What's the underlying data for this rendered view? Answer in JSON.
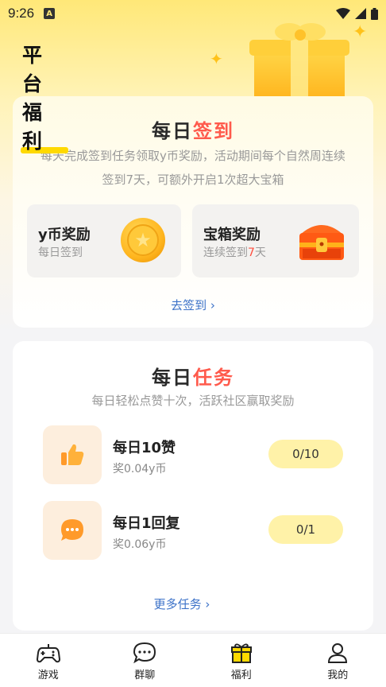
{
  "status_bar": {
    "time": "9:26",
    "a_badge": "A"
  },
  "header": {
    "title": "平台福利"
  },
  "checkin": {
    "title_a": "每日",
    "title_b": "签到",
    "description_line1": "每天完成签到任务领取y币奖励，活动期间每个自然周连续",
    "description_line2": "签到7天，可额外开启1次超大宝箱",
    "coin_reward": {
      "title": "y币奖励",
      "subtitle": "每日签到"
    },
    "chest_reward": {
      "title": "宝箱奖励",
      "subtitle_a": "连续签到",
      "subtitle_days": "7",
      "subtitle_b": "天"
    },
    "action_link": "去签到"
  },
  "tasks": {
    "title_a": "每日",
    "title_b": "任务",
    "description": "每日轻松点赞十次，活跃社区赢取奖励",
    "items": [
      {
        "title": "每日10赞",
        "reward": "奖0.04y币",
        "progress": "0/10",
        "icon": "thumbs-up-icon"
      },
      {
        "title": "每日1回复",
        "reward": "奖0.06y币",
        "progress": "0/1",
        "icon": "chat-bubble-icon"
      }
    ],
    "more_link": "更多任务"
  },
  "tabbar": {
    "items": [
      {
        "label": "游戏",
        "icon": "gamepad-icon"
      },
      {
        "label": "群聊",
        "icon": "chat-icon"
      },
      {
        "label": "福利",
        "icon": "gift-icon"
      },
      {
        "label": "我的",
        "icon": "user-icon"
      }
    ]
  },
  "colors": {
    "accent_yellow": "#ffd900",
    "accent_red": "#ff5a4c",
    "link_blue": "#3c72c8"
  }
}
